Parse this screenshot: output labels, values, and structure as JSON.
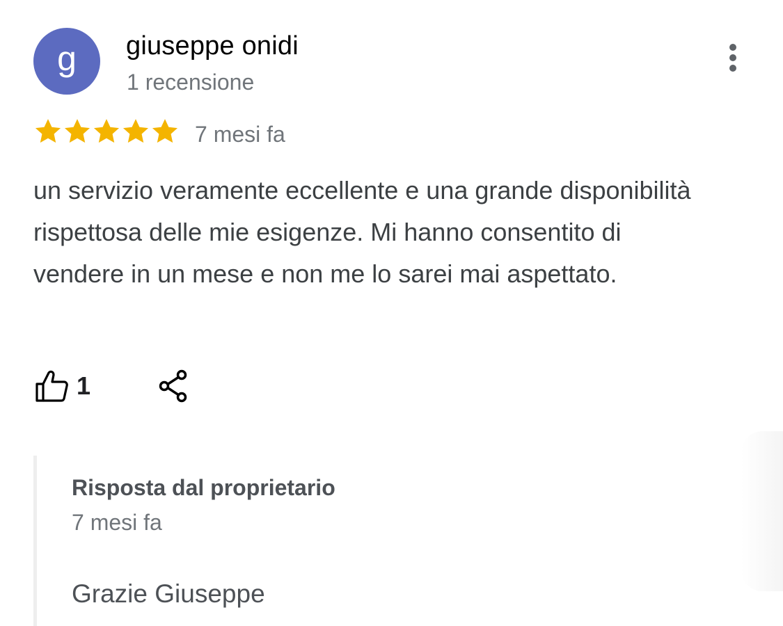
{
  "review": {
    "author": {
      "initial": "g",
      "name": "giuseppe onidi",
      "review_count": "1 recensione",
      "avatar_color": "#5c6bc0"
    },
    "rating": 5,
    "rating_max": 5,
    "star_color": "#f4b400",
    "date": "7 mesi fa",
    "text": "un servizio veramente eccellente e una grande disponibilità rispettosa delle mie esigenze. Mi hanno consentito di vendere in un mese e non me lo sarei mai aspettato.",
    "actions": {
      "like_icon": "thumbs-up-icon",
      "like_count": "1",
      "share_icon": "share-icon",
      "more_icon": "more-vert-icon"
    }
  },
  "owner_reply": {
    "title": "Risposta dal proprietario",
    "date": "7 mesi fa",
    "text": "Grazie Giuseppe"
  }
}
